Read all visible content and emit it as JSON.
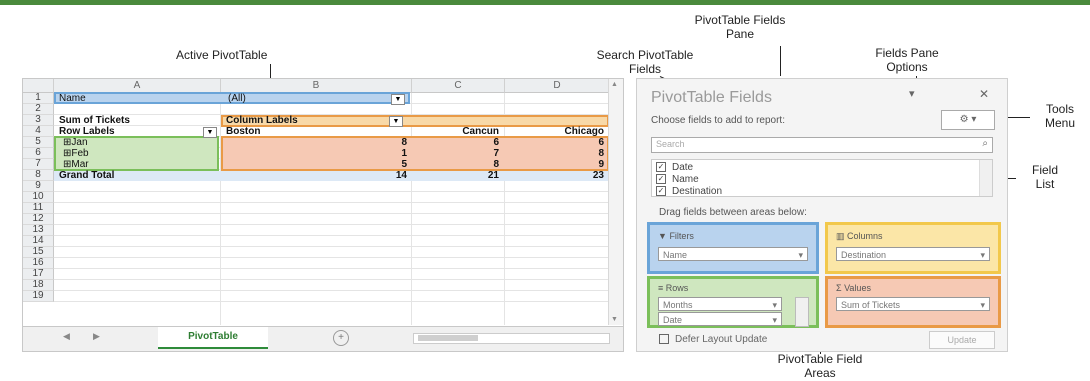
{
  "callouts": {
    "active_pivottable": "Active PivotTable",
    "fields_pane_l1": "PivotTable Fields",
    "fields_pane_l2": "Pane",
    "search_l1": "Search PivotTable",
    "search_l2": "Fields",
    "options_l1": "Fields Pane",
    "options_l2": "Options",
    "tools_l1": "Tools",
    "tools_l2": "Menu",
    "field_list_l1": "Field",
    "field_list_l2": "List",
    "areas_l1": "PivotTable Field",
    "areas_l2": "Areas"
  },
  "sheet": {
    "columns": [
      "A",
      "B",
      "C",
      "D"
    ],
    "rows": [
      "1",
      "2",
      "3",
      "4",
      "5",
      "6",
      "7",
      "8",
      "9",
      "10",
      "11",
      "12",
      "13",
      "14",
      "15",
      "16",
      "17",
      "18",
      "19"
    ],
    "filter_label": "Name",
    "filter_value": "(All)",
    "values_label": "Sum of Tickets",
    "column_labels": "Column Labels",
    "row_labels": "Row Labels",
    "destinations": [
      "Boston",
      "Cancun",
      "Chicago"
    ],
    "data_rows": [
      {
        "label": "Jan",
        "values": [
          "8",
          "6",
          "6"
        ]
      },
      {
        "label": "Feb",
        "values": [
          "1",
          "7",
          "8"
        ]
      },
      {
        "label": "Mar",
        "values": [
          "5",
          "8",
          "9"
        ]
      }
    ],
    "grand_total_label": "Grand Total",
    "grand_totals": [
      "14",
      "21",
      "23"
    ],
    "tab_name": "PivotTable"
  },
  "pane": {
    "title": "PivotTable Fields",
    "choose_fields": "Choose fields to add to report:",
    "search_placeholder": "Search",
    "fields": [
      "Date",
      "Name",
      "Destination"
    ],
    "drag_text": "Drag fields between areas below:",
    "areas": {
      "filters_title": "Filters",
      "filters_item": "Name",
      "columns_title": "Columns",
      "columns_item": "Destination",
      "rows_title": "Rows",
      "rows_items": [
        "Months",
        "Date"
      ],
      "values_title": "Values",
      "values_item": "Sum of Tickets"
    },
    "defer_label": "Defer Layout Update",
    "update_label": "Update"
  },
  "colors": {
    "blue": "#6aa4d8",
    "orange": "#e99a46",
    "green": "#7bbf5a",
    "yellow": "#f2c84b"
  }
}
